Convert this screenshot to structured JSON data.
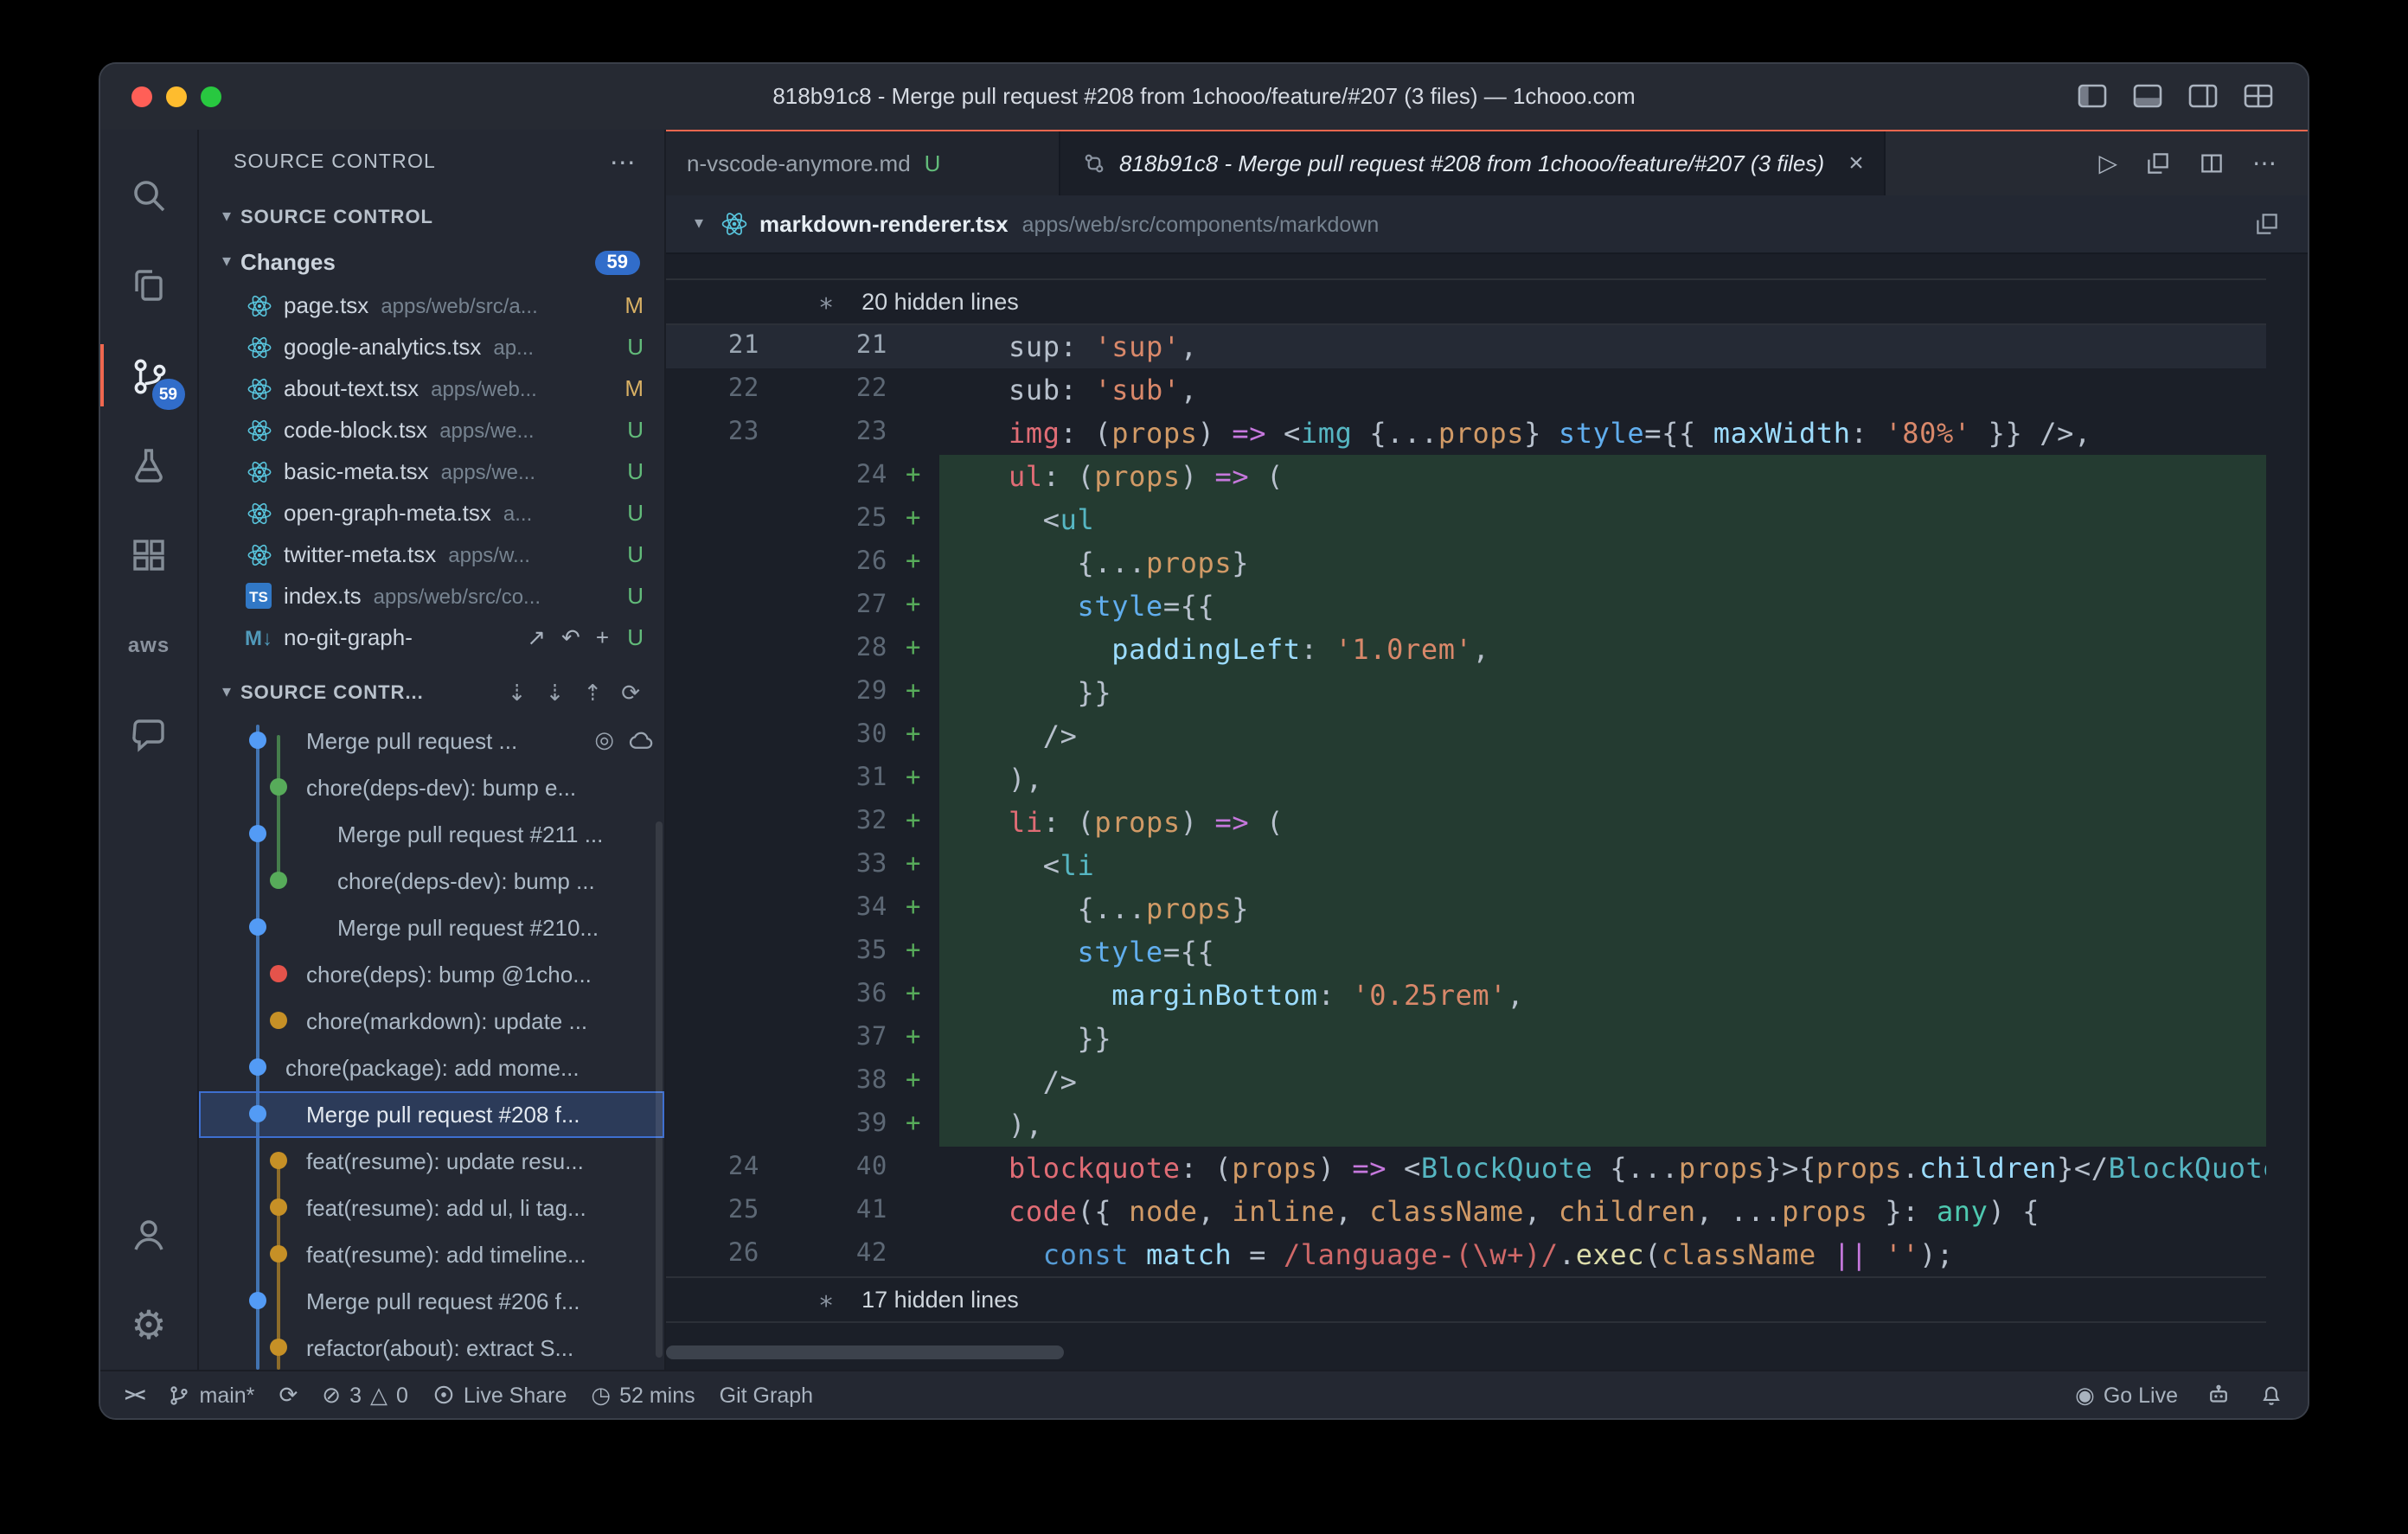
{
  "colors": {
    "accent_orange": "#f0674f",
    "badge_blue": "#316dca",
    "traffic_red": "#ff5f57",
    "traffic_yellow": "#febc2e",
    "traffic_green": "#28c840",
    "added_line_green": "#57ab5a",
    "modified_yellow": "#d8b064",
    "untracked_green": "#62bb7a",
    "graph_blue": "#539bf5",
    "graph_green": "#57ab5a",
    "graph_yellow": "#c69026",
    "graph_red": "#e5534b"
  },
  "window": {
    "title": "818b91c8 - Merge pull request #208 from 1chooo/feature/#207 (3 files) — 1chooo.com"
  },
  "activity": {
    "badge": "59",
    "aws": "aws"
  },
  "sidebar": {
    "title": "SOURCE CONTROL",
    "section_label": "SOURCE CONTROL",
    "changes_label": "Changes",
    "changes_badge": "59",
    "graph_label": "SOURCE CONTR...",
    "files": [
      {
        "name": "page.tsx",
        "path": "apps/web/src/a...",
        "status": "M",
        "icon": "react"
      },
      {
        "name": "google-analytics.tsx",
        "path": "ap...",
        "status": "U",
        "icon": "react"
      },
      {
        "name": "about-text.tsx",
        "path": "apps/web...",
        "status": "M",
        "icon": "react"
      },
      {
        "name": "code-block.tsx",
        "path": "apps/we...",
        "status": "U",
        "icon": "react"
      },
      {
        "name": "basic-meta.tsx",
        "path": "apps/we...",
        "status": "U",
        "icon": "react"
      },
      {
        "name": "open-graph-meta.tsx",
        "path": "a...",
        "status": "U",
        "icon": "react"
      },
      {
        "name": "twitter-meta.tsx",
        "path": "apps/w...",
        "status": "U",
        "icon": "react"
      },
      {
        "name": "index.ts",
        "path": "apps/web/src/co...",
        "status": "U",
        "icon": "ts"
      },
      {
        "name": "no-git-graph-",
        "path": "",
        "status": "U",
        "icon": "md",
        "actions": true
      }
    ],
    "graph": [
      {
        "label": "Merge pull request ...",
        "dot": "blue",
        "flags": [],
        "icons": true
      },
      {
        "label": "chore(deps-dev): bump e...",
        "dot": "green",
        "flags": [
          "c1"
        ]
      },
      {
        "label": "Merge pull request #211 ...",
        "dot": "blue",
        "flags": [
          "ind"
        ]
      },
      {
        "label": "chore(deps-dev): bump ...",
        "dot": "green",
        "flags": [
          "c1",
          "ind"
        ]
      },
      {
        "label": "Merge pull request #210...",
        "dot": "blue",
        "flags": [
          "ind"
        ]
      },
      {
        "label": "chore(deps): bump @1cho...",
        "dot": "red",
        "flags": [
          "c1"
        ]
      },
      {
        "label": "chore(markdown): update ...",
        "dot": "yellow",
        "flags": [
          "c1"
        ]
      },
      {
        "label": "chore(package): add mome...",
        "dot": "blue",
        "flags": [
          "tight"
        ]
      },
      {
        "label": "Merge pull request #208 f...",
        "dot": "blue",
        "flags": [
          "selected"
        ]
      },
      {
        "label": "feat(resume): update resu...",
        "dot": "yellow",
        "flags": [
          "c1"
        ]
      },
      {
        "label": "feat(resume): add ul, li tag...",
        "dot": "yellow",
        "flags": [
          "c1"
        ]
      },
      {
        "label": "feat(resume): add timeline...",
        "dot": "yellow",
        "flags": [
          "c1"
        ]
      },
      {
        "label": "Merge pull request #206 f...",
        "dot": "blue",
        "flags": []
      },
      {
        "label": "refactor(about): extract S...",
        "dot": "yellow",
        "flags": [
          "c1"
        ]
      }
    ]
  },
  "editor": {
    "tab1": {
      "label": "n-vscode-anymore.md",
      "status": "U"
    },
    "tab2": {
      "label": "818b91c8 - Merge pull request #208 from 1chooo/feature/#207 (3 files)",
      "close": "×"
    },
    "breadcrumb": {
      "file": "markdown-renderer.tsx",
      "path": "apps/web/src/components/markdown"
    },
    "hidden_top": "20 hidden lines",
    "hidden_bottom": "17 hidden lines",
    "lines": [
      {
        "old": "21",
        "new": "21",
        "mark": "",
        "flags": [
          "cur"
        ],
        "tokens": [
          [
            "pl",
            "sup: "
          ],
          [
            "str",
            "'sup'"
          ],
          [
            "pl",
            ","
          ]
        ]
      },
      {
        "old": "22",
        "new": "22",
        "mark": "",
        "flags": [],
        "tokens": [
          [
            "pl",
            "sub: "
          ],
          [
            "str",
            "'sub'"
          ],
          [
            "pl",
            ","
          ]
        ]
      },
      {
        "old": "23",
        "new": "23",
        "mark": "",
        "flags": [],
        "tokens": [
          [
            "key",
            "img"
          ],
          [
            "pl",
            ": ("
          ],
          [
            "param",
            "props"
          ],
          [
            "pl",
            ") "
          ],
          [
            "op",
            "=>"
          ],
          [
            "pl",
            " <"
          ],
          [
            "tag",
            "img"
          ],
          [
            "pl",
            " {..."
          ],
          [
            "param",
            "props"
          ],
          [
            "pl",
            "} "
          ],
          [
            "attr",
            "style"
          ],
          [
            "pl",
            "={{ "
          ],
          [
            "prop",
            "maxWidth"
          ],
          [
            "pl",
            ": "
          ],
          [
            "str",
            "'80%'"
          ],
          [
            "pl",
            " }} />,"
          ]
        ]
      },
      {
        "old": "",
        "new": "24",
        "mark": "+",
        "flags": [
          "added"
        ],
        "tokens": [
          [
            "key",
            "ul"
          ],
          [
            "pl",
            ": ("
          ],
          [
            "param",
            "props"
          ],
          [
            "pl",
            ") "
          ],
          [
            "op",
            "=>"
          ],
          [
            "pl",
            " ("
          ]
        ]
      },
      {
        "old": "",
        "new": "25",
        "mark": "+",
        "flags": [
          "added"
        ],
        "tokens": [
          [
            "pl",
            "  <"
          ],
          [
            "tag",
            "ul"
          ]
        ]
      },
      {
        "old": "",
        "new": "26",
        "mark": "+",
        "flags": [
          "added"
        ],
        "tokens": [
          [
            "pl",
            "    {..."
          ],
          [
            "param",
            "props"
          ],
          [
            "pl",
            "}"
          ]
        ]
      },
      {
        "old": "",
        "new": "27",
        "mark": "+",
        "flags": [
          "added"
        ],
        "tokens": [
          [
            "pl",
            "    "
          ],
          [
            "attr",
            "style"
          ],
          [
            "pl",
            "={{"
          ]
        ]
      },
      {
        "old": "",
        "new": "28",
        "mark": "+",
        "flags": [
          "added"
        ],
        "tokens": [
          [
            "pl",
            "      "
          ],
          [
            "prop",
            "paddingLeft"
          ],
          [
            "pl",
            ": "
          ],
          [
            "str",
            "'1.0rem'"
          ],
          [
            "pl",
            ","
          ]
        ]
      },
      {
        "old": "",
        "new": "29",
        "mark": "+",
        "flags": [
          "added"
        ],
        "tokens": [
          [
            "pl",
            "    }}"
          ]
        ]
      },
      {
        "old": "",
        "new": "30",
        "mark": "+",
        "flags": [
          "added"
        ],
        "tokens": [
          [
            "pl",
            "  />"
          ]
        ]
      },
      {
        "old": "",
        "new": "31",
        "mark": "+",
        "flags": [
          "added"
        ],
        "tokens": [
          [
            "pl",
            "),"
          ]
        ]
      },
      {
        "old": "",
        "new": "32",
        "mark": "+",
        "flags": [
          "added"
        ],
        "tokens": [
          [
            "key",
            "li"
          ],
          [
            "pl",
            ": ("
          ],
          [
            "param",
            "props"
          ],
          [
            "pl",
            ") "
          ],
          [
            "op",
            "=>"
          ],
          [
            "pl",
            " ("
          ]
        ]
      },
      {
        "old": "",
        "new": "33",
        "mark": "+",
        "flags": [
          "added"
        ],
        "tokens": [
          [
            "pl",
            "  <"
          ],
          [
            "tag",
            "li"
          ]
        ]
      },
      {
        "old": "",
        "new": "34",
        "mark": "+",
        "flags": [
          "added"
        ],
        "tokens": [
          [
            "pl",
            "    {..."
          ],
          [
            "param",
            "props"
          ],
          [
            "pl",
            "}"
          ]
        ]
      },
      {
        "old": "",
        "new": "35",
        "mark": "+",
        "flags": [
          "added"
        ],
        "tokens": [
          [
            "pl",
            "    "
          ],
          [
            "attr",
            "style"
          ],
          [
            "pl",
            "={{"
          ]
        ]
      },
      {
        "old": "",
        "new": "36",
        "mark": "+",
        "flags": [
          "added"
        ],
        "tokens": [
          [
            "pl",
            "      "
          ],
          [
            "prop",
            "marginBottom"
          ],
          [
            "pl",
            ": "
          ],
          [
            "str",
            "'0.25rem'"
          ],
          [
            "pl",
            ","
          ]
        ]
      },
      {
        "old": "",
        "new": "37",
        "mark": "+",
        "flags": [
          "added"
        ],
        "tokens": [
          [
            "pl",
            "    }}"
          ]
        ]
      },
      {
        "old": "",
        "new": "38",
        "mark": "+",
        "flags": [
          "added"
        ],
        "tokens": [
          [
            "pl",
            "  />"
          ]
        ]
      },
      {
        "old": "",
        "new": "39",
        "mark": "+",
        "flags": [
          "added"
        ],
        "tokens": [
          [
            "pl",
            "),"
          ]
        ]
      },
      {
        "old": "24",
        "new": "40",
        "mark": "",
        "flags": [],
        "tokens": [
          [
            "key",
            "blockquote"
          ],
          [
            "pl",
            ": ("
          ],
          [
            "param",
            "props"
          ],
          [
            "pl",
            ") "
          ],
          [
            "op",
            "=>"
          ],
          [
            "pl",
            " <"
          ],
          [
            "tag",
            "BlockQuote"
          ],
          [
            "pl",
            " {..."
          ],
          [
            "param",
            "props"
          ],
          [
            "pl",
            "}>{"
          ],
          [
            "param",
            "props"
          ],
          [
            "pl",
            "."
          ],
          [
            "prop",
            "children"
          ],
          [
            "pl",
            "}</"
          ],
          [
            "tag",
            "BlockQuote"
          ],
          [
            "pl",
            ">,"
          ]
        ]
      },
      {
        "old": "25",
        "new": "41",
        "mark": "",
        "flags": [],
        "tokens": [
          [
            "key",
            "code"
          ],
          [
            "pl",
            "({ "
          ],
          [
            "param",
            "node"
          ],
          [
            "pl",
            ", "
          ],
          [
            "param",
            "inline"
          ],
          [
            "pl",
            ", "
          ],
          [
            "param",
            "className"
          ],
          [
            "pl",
            ", "
          ],
          [
            "param",
            "children"
          ],
          [
            "pl",
            ", ..."
          ],
          [
            "param",
            "props"
          ],
          [
            "pl",
            " }: "
          ],
          [
            "type",
            "any"
          ],
          [
            "pl",
            ") {"
          ]
        ]
      },
      {
        "old": "26",
        "new": "42",
        "mark": "",
        "flags": [],
        "tokens": [
          [
            "pl",
            "  "
          ],
          [
            "kw",
            "const"
          ],
          [
            "pl",
            " "
          ],
          [
            "var",
            "match"
          ],
          [
            "pl",
            " = "
          ],
          [
            "regex",
            "/language-(\\w+)/"
          ],
          [
            "pl",
            "."
          ],
          [
            "fn",
            "exec"
          ],
          [
            "pl",
            "("
          ],
          [
            "param",
            "className"
          ],
          [
            "pl",
            " "
          ],
          [
            "op",
            "||"
          ],
          [
            "pl",
            " "
          ],
          [
            "str",
            "''"
          ],
          [
            "pl",
            ");"
          ]
        ]
      }
    ]
  },
  "status": {
    "branch": "main*",
    "errors": "3",
    "warnings": "0",
    "live_share": "Live Share",
    "timer": "52 mins",
    "git_graph": "Git Graph",
    "go_live": "Go Live"
  }
}
